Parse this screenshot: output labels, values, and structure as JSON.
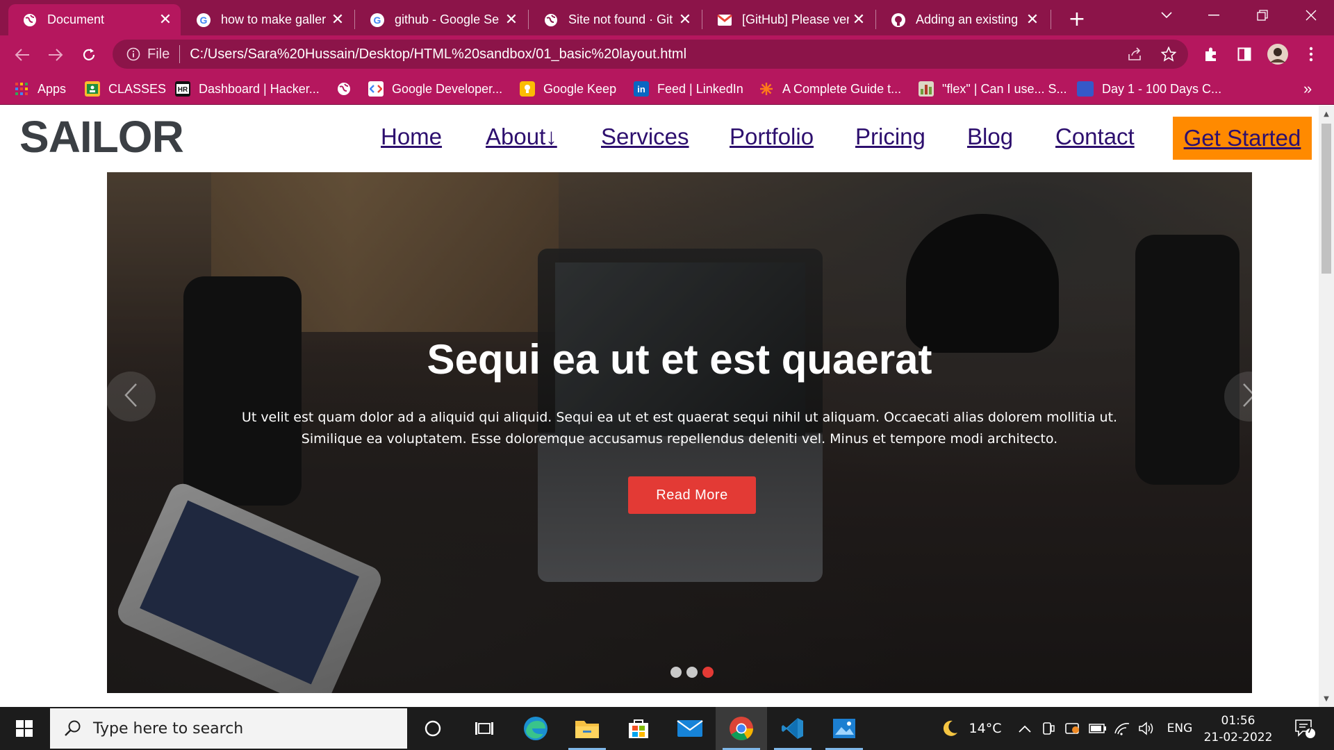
{
  "browser": {
    "tabs": [
      {
        "label": "Document",
        "icon": "globe-icon",
        "active": true
      },
      {
        "label": "how to make galler",
        "icon": "google-icon",
        "active": false
      },
      {
        "label": "github - Google Se",
        "icon": "google-icon",
        "active": false
      },
      {
        "label": "Site not found · Git",
        "icon": "globe-icon",
        "active": false
      },
      {
        "label": "[GitHub] Please veri",
        "icon": "gmail-icon",
        "active": false
      },
      {
        "label": "Adding an existing",
        "icon": "github-icon",
        "active": false
      }
    ],
    "omnibox": {
      "scheme": "File",
      "url": "C:/Users/Sara%20Hussain/Desktop/HTML%20sandbox/01_basic%20layout.html"
    },
    "bookmarks": [
      {
        "label": "Apps",
        "icon": "apps-grid-icon",
        "color": "#e94235"
      },
      {
        "label": "CLASSES",
        "icon": "classroom-icon",
        "color": "#f9bb2d"
      },
      {
        "label": "Dashboard | Hacker...",
        "icon": "hackerrank-icon",
        "color": "#111111"
      },
      {
        "label": "",
        "icon": "globe-icon",
        "color": "#ffffff"
      },
      {
        "label": "Google Developer...",
        "icon": "google-developers-icon",
        "color": "#ffffff"
      },
      {
        "label": "Google Keep",
        "icon": "keep-icon",
        "color": "#fbbc04"
      },
      {
        "label": "Feed | LinkedIn",
        "icon": "linkedin-icon",
        "color": "#0a66c2"
      },
      {
        "label": "A Complete Guide t...",
        "icon": "css-tricks-icon",
        "color": "#e8612c"
      },
      {
        "label": "\"flex\" | Can I use... S...",
        "icon": "caniuse-icon",
        "color": "#7a9a4b"
      },
      {
        "label": "Day 1 - 100 Days C...",
        "icon": "bookmark-blue-icon",
        "color": "#3559c9"
      }
    ],
    "bookmarks_more": "»"
  },
  "page": {
    "logo": "SAILOR",
    "nav": [
      "Home",
      "About↓",
      "Services",
      "Portfolio",
      "Pricing",
      "Blog",
      "Contact"
    ],
    "cta": "Get Started",
    "hero": {
      "title": "Sequi ea ut et est quaerat",
      "text": "Ut velit est quam dolor ad a aliquid qui aliquid. Sequi ea ut et est quaerat sequi nihil ut aliquam. Occaecati alias dolorem mollitia ut. Similique ea voluptatem. Esse doloremque accusamus repellendus deleniti vel. Minus et tempore modi architecto.",
      "button": "Read More",
      "slides": 3,
      "active_slide": 3
    },
    "colors": {
      "accent": "#ff8a00",
      "button": "#e33a35",
      "link": "#2d0f6e"
    }
  },
  "taskbar": {
    "search_placeholder": "Type here to search",
    "apps": [
      "cortana-icon",
      "task-view-icon",
      "edge-icon",
      "file-explorer-icon",
      "store-icon",
      "mail-icon",
      "chrome-icon",
      "vscode-icon",
      "photos-icon"
    ],
    "weather": "14°C",
    "language": "ENG",
    "time": "01:56",
    "date": "21-02-2022",
    "notifications": "7"
  }
}
